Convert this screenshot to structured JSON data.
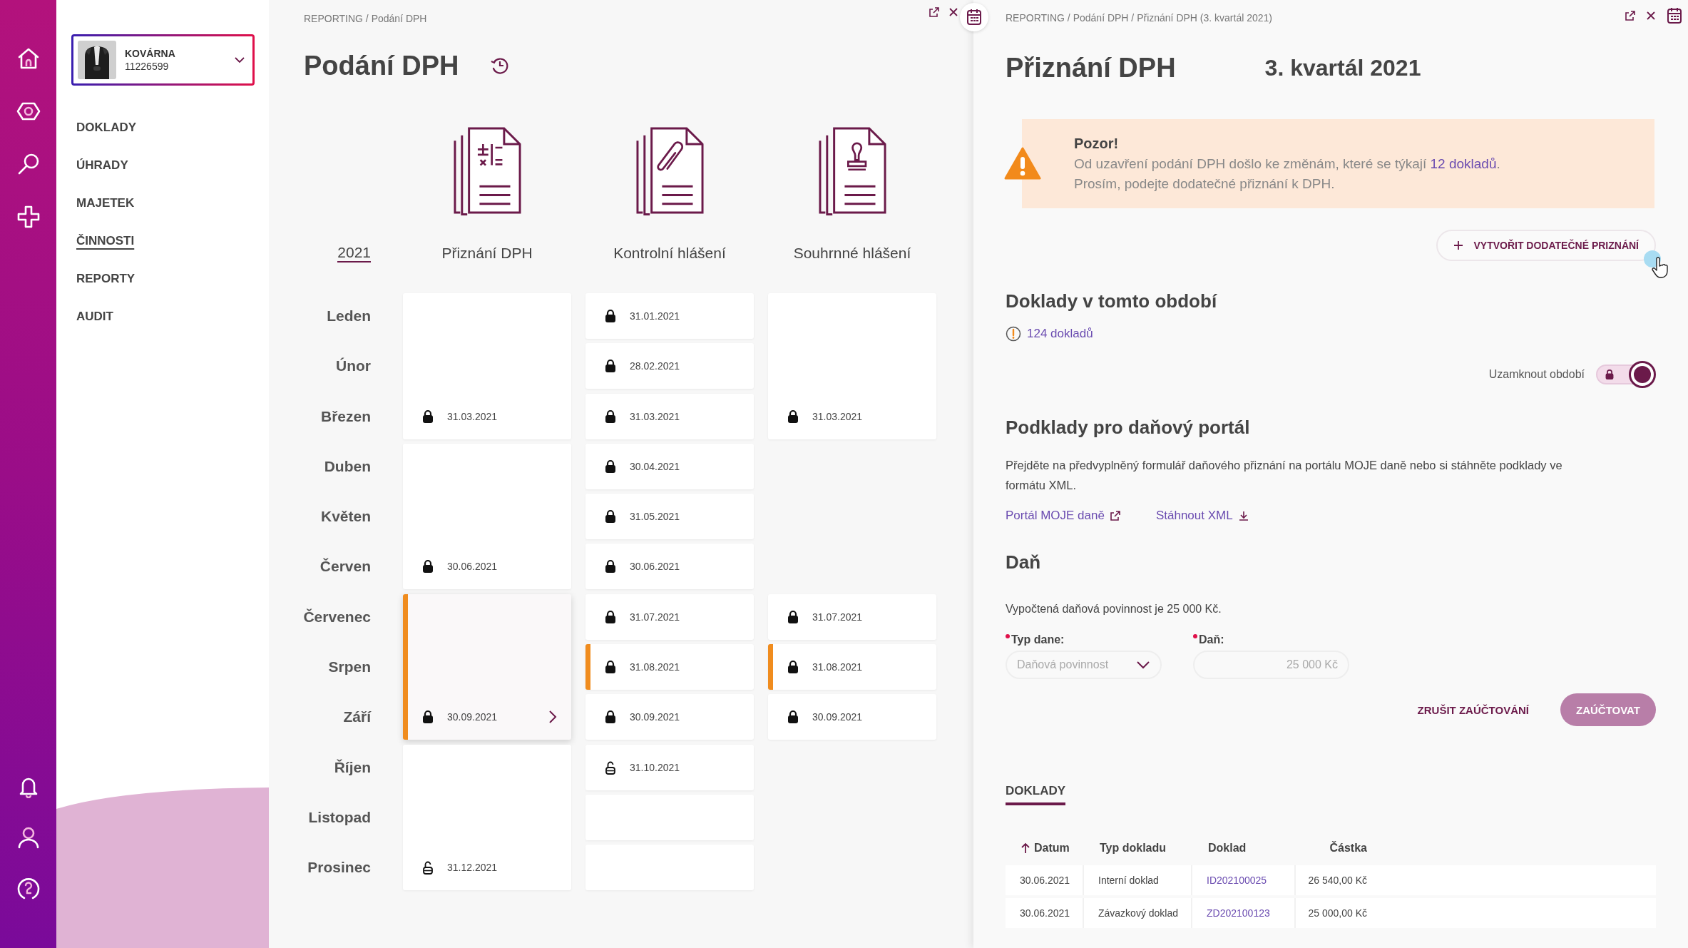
{
  "company": {
    "name": "KOVÁRNA",
    "id": "11226599"
  },
  "nav": [
    {
      "label": "DOKLADY",
      "selected": false
    },
    {
      "label": "ÚHRADY",
      "selected": false
    },
    {
      "label": "MAJETEK",
      "selected": false
    },
    {
      "label": "ČINNOSTI",
      "selected": true
    },
    {
      "label": "REPORTY",
      "selected": false
    },
    {
      "label": "AUDIT",
      "selected": false
    }
  ],
  "overview": {
    "breadcrumb": "REPORTING / Podání DPH",
    "title": "Podání DPH",
    "year": "2021",
    "months": [
      "Leden",
      "Únor",
      "Březen",
      "Duben",
      "Květen",
      "Červen",
      "Červenec",
      "Srpen",
      "Září",
      "Říjen",
      "Listopad",
      "Prosinec"
    ],
    "columns": [
      {
        "title": "Přiznání DPH",
        "cards": [
          {
            "kind": "card",
            "quarterly": true,
            "date": "31.03.2021",
            "locked": true,
            "changed": false,
            "selected": false
          },
          {
            "kind": "card",
            "quarterly": true,
            "date": "30.06.2021",
            "locked": true,
            "changed": false,
            "selected": false
          },
          {
            "kind": "card",
            "quarterly": true,
            "date": "30.09.2021",
            "locked": true,
            "changed": true,
            "selected": true
          },
          {
            "kind": "card",
            "quarterly": true,
            "date": "31.12.2021",
            "locked": false,
            "changed": false,
            "selected": false
          }
        ]
      },
      {
        "title": "Kontrolní hlášení",
        "cards": [
          {
            "kind": "card",
            "quarterly": false,
            "date": "31.01.2021",
            "locked": true,
            "changed": false,
            "selected": false
          },
          {
            "kind": "card",
            "quarterly": false,
            "date": "28.02.2021",
            "locked": true,
            "changed": false,
            "selected": false
          },
          {
            "kind": "card",
            "quarterly": false,
            "date": "31.03.2021",
            "locked": true,
            "changed": false,
            "selected": false
          },
          {
            "kind": "card",
            "quarterly": false,
            "date": "30.04.2021",
            "locked": true,
            "changed": false,
            "selected": false
          },
          {
            "kind": "card",
            "quarterly": false,
            "date": "31.05.2021",
            "locked": true,
            "changed": false,
            "selected": false
          },
          {
            "kind": "card",
            "quarterly": false,
            "date": "30.06.2021",
            "locked": true,
            "changed": false,
            "selected": false
          },
          {
            "kind": "card",
            "quarterly": false,
            "date": "31.07.2021",
            "locked": true,
            "changed": false,
            "selected": false
          },
          {
            "kind": "card",
            "quarterly": false,
            "date": "31.08.2021",
            "locked": true,
            "changed": true,
            "selected": false
          },
          {
            "kind": "card",
            "quarterly": false,
            "date": "30.09.2021",
            "locked": true,
            "changed": false,
            "selected": false
          },
          {
            "kind": "card",
            "quarterly": false,
            "date": "31.10.2021",
            "locked": false,
            "changed": false,
            "selected": false
          },
          {
            "kind": "card",
            "quarterly": false,
            "changed": false,
            "selected": false
          },
          {
            "kind": "card",
            "quarterly": false,
            "changed": false,
            "selected": false
          }
        ]
      },
      {
        "title": "Souhrnné hlášení",
        "cards": [
          {
            "kind": "card",
            "quarterly": true,
            "date": "31.03.2021",
            "locked": true,
            "changed": false,
            "selected": false
          },
          {
            "kind": "gap"
          },
          {
            "kind": "card",
            "quarterly": false,
            "date": "31.07.2021",
            "locked": true,
            "changed": false,
            "selected": false
          },
          {
            "kind": "card",
            "quarterly": false,
            "date": "31.08.2021",
            "locked": true,
            "changed": true,
            "selected": false
          },
          {
            "kind": "card",
            "quarterly": false,
            "date": "30.09.2021",
            "locked": true,
            "changed": false,
            "selected": false
          },
          {
            "kind": "gap"
          }
        ]
      }
    ]
  },
  "detail": {
    "breadcrumb": "REPORTING / Podání DPH / Přiznání DPH (3. kvartál 2021)",
    "title": "Přiznání DPH",
    "period": "3. kvartál 2021",
    "alert": {
      "title": "Pozor!",
      "text_before": "Od uzavření podání DPH došlo ke změnám, které se týkají ",
      "link": "12 dokladů",
      "text_after": ".",
      "note": "Prosím, podejte dodatečné přiznání k DPH."
    },
    "create_button": "VYTVOŘIT DODATEČNÉ PRIZNÁNÍ",
    "documents": {
      "heading": "Doklady v tomto období",
      "count_link": "124 dokladů"
    },
    "lock": {
      "label": "Uzamknout období",
      "on": true
    },
    "portal": {
      "heading": "Podklady pro daňový portál",
      "text": "Přejděte na předvyplněný formulář daňového přiznání na portálu MOJE daně nebo si stáhněte podklady ve formátu XML.",
      "links": [
        {
          "label": "Portál MOJE daně",
          "kind": "external"
        },
        {
          "label": "Stáhnout XML",
          "kind": "download"
        }
      ]
    },
    "tax": {
      "heading": "Daň",
      "summary": "Vypočtená daňová povinnost je 25 000 Kč.",
      "fields": [
        {
          "label": "Typ dane:",
          "kind": "select",
          "value": "Daňová povinnost",
          "required": true,
          "disabled": true
        },
        {
          "label": "Daň:",
          "kind": "input",
          "value": "25 000 Kč",
          "required": true,
          "disabled": true
        }
      ],
      "buttons": [
        {
          "label": "ZRUŠIT ZAÚČTOVÁNÍ",
          "kind": "text"
        },
        {
          "label": "ZAÚČTOVAT",
          "kind": "primary"
        }
      ]
    },
    "tabs": [
      {
        "label": "DOKLADY",
        "selected": true
      }
    ],
    "table": {
      "columns": [
        {
          "label": "Datum",
          "sorted": true
        },
        {
          "label": "Typ dokladu"
        },
        {
          "label": "Doklad"
        },
        {
          "label": "Částka"
        }
      ],
      "rows": [
        [
          "30.06.2021",
          "Interní doklad",
          "ID202100025",
          "26 540,00 Kč"
        ],
        [
          "30.06.2021",
          "Závazkový doklad",
          "ZD202100123",
          "25 000,00 Kč"
        ]
      ]
    }
  }
}
